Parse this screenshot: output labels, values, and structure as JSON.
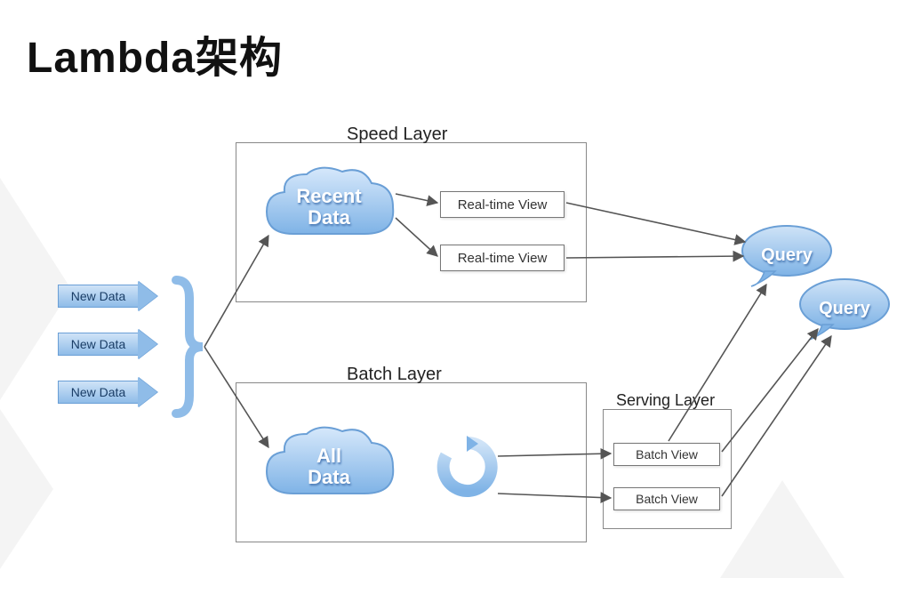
{
  "title": "Lambda架构",
  "inputs": [
    "New Data",
    "New Data",
    "New Data"
  ],
  "speed_layer": {
    "label": "Speed Layer",
    "cloud": "Recent\nData",
    "views": [
      "Real-time View",
      "Real-time View"
    ]
  },
  "batch_layer": {
    "label": "Batch Layer",
    "cloud": "All\nData",
    "recycle_icon": "recycle-icon"
  },
  "serving_layer": {
    "label": "Serving Layer",
    "views": [
      "Batch View",
      "Batch View"
    ]
  },
  "queries": [
    "Query",
    "Query"
  ],
  "colors": {
    "blue": "#8fbce8",
    "blue_dark": "#6a9fd6",
    "stroke": "#555"
  }
}
